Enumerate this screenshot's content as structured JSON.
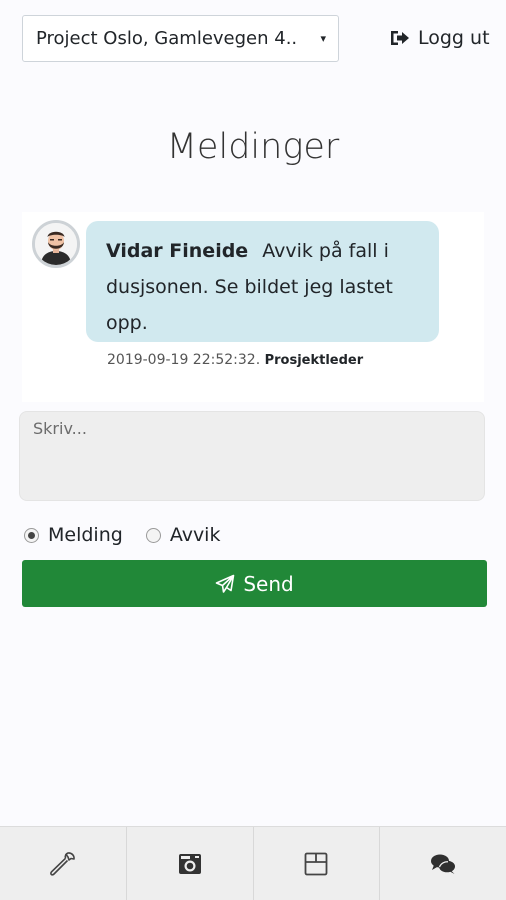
{
  "header": {
    "project_select": {
      "selected": "Project Oslo, Gamlevegen 4..",
      "caret": "▾"
    },
    "logout_label": "Logg ut"
  },
  "page_title": "Meldinger",
  "messages": [
    {
      "author": "Vidar Fineide",
      "text": "Avvik på fall i dusjsonen. Se bildet jeg lastet opp.",
      "timestamp": "2019-09-19 22:52:32.",
      "role": "Prosjektleder"
    }
  ],
  "compose": {
    "placeholder": "Skriv...",
    "value": ""
  },
  "message_type": {
    "options": [
      "Melding",
      "Avvik"
    ],
    "selected": "Melding"
  },
  "send_label": "Send",
  "bottom_nav": {
    "items": [
      {
        "icon": "wrench-icon"
      },
      {
        "icon": "camera-icon"
      },
      {
        "icon": "box-icon"
      },
      {
        "icon": "comments-icon"
      }
    ],
    "active_index": 3
  },
  "colors": {
    "send_button": "#218838",
    "bubble": "#d1e9ef",
    "nav_bg": "#eeeeee",
    "page_bg": "#fbfbfe"
  }
}
